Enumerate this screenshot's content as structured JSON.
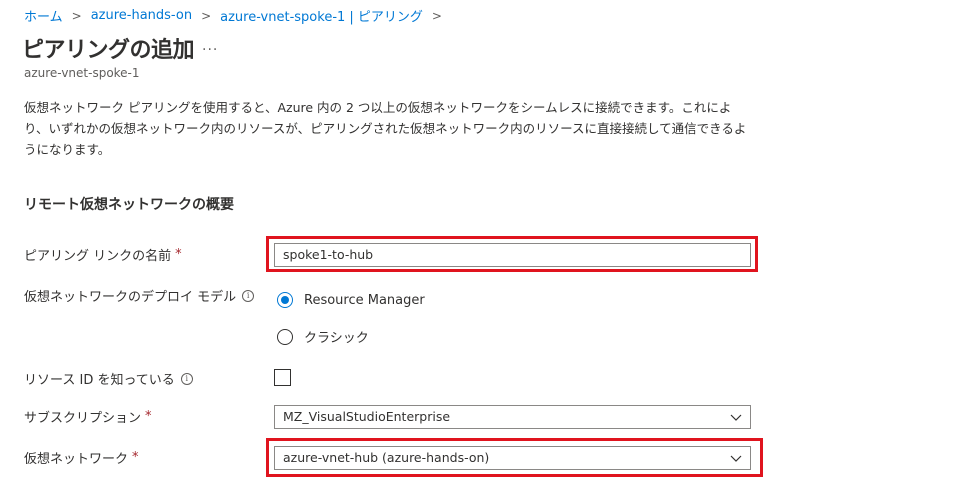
{
  "breadcrumb": {
    "items": [
      "ホーム",
      "azure-hands-on",
      "azure-vnet-spoke-1 | ピアリング"
    ],
    "separator": ">"
  },
  "page": {
    "title": "ピアリングの追加",
    "more": "...",
    "subtitle": "azure-vnet-spoke-1",
    "description": "仮想ネットワーク ピアリングを使用すると、Azure 内の 2 つ以上の仮想ネットワークをシームレスに接続できます。これにより、いずれかの仮想ネットワーク内のリソースが、ピアリングされた仮想ネットワーク内のリソースに直接接続して通信できるようになります。"
  },
  "section": {
    "title": "リモート仮想ネットワークの概要"
  },
  "fields": {
    "link_name": {
      "label": "ピアリング リンクの名前",
      "required": "*",
      "value": "spoke1-to-hub"
    },
    "deploy_model": {
      "label": "仮想ネットワークのデプロイ モデル",
      "info": "i",
      "options": [
        "Resource Manager",
        "クラシック"
      ],
      "selected": "Resource Manager"
    },
    "resource_id": {
      "label": "リソース ID を知っている",
      "info": "i",
      "checked": false
    },
    "subscription": {
      "label": "サブスクリプション",
      "required": "*",
      "value": "MZ_VisualStudioEnterprise"
    },
    "vnet": {
      "label": "仮想ネットワーク",
      "required": "*",
      "value": "azure-vnet-hub (azure-hands-on)"
    }
  },
  "colors": {
    "accent": "#0078d4",
    "highlight": "#e0141e",
    "required": "#a4262c",
    "text": "#323130"
  }
}
